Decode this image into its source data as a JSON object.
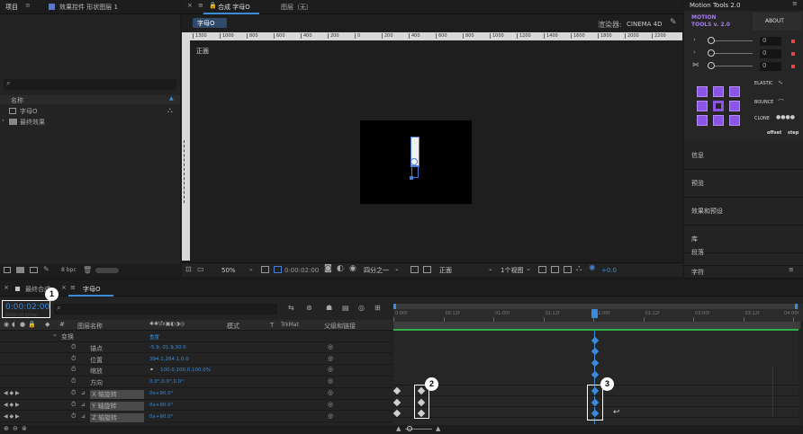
{
  "project_panel": {
    "title": "项目",
    "effects_tab": "效果控件 形状图层 1",
    "column_name": "名称",
    "items": [
      "字母O",
      "最终效果"
    ],
    "bpc": "8 bpc"
  },
  "composition_panel": {
    "tab": "合成 字母O",
    "layer_tab": "图层（无）",
    "comp_chip": "字母O",
    "renderer_label": "渲染器:",
    "renderer_value": "CINEMA 4D",
    "view_label": "正面",
    "ruler": [
      "1300",
      "1000",
      "800",
      "600",
      "400",
      "200",
      "0",
      "200",
      "400",
      "600",
      "800",
      "1000",
      "1200",
      "1400",
      "1600",
      "1800",
      "2000",
      "2200"
    ],
    "zoom": "50%",
    "timecode": "0:00:02:00",
    "resolution": "四分之一",
    "camera": "正面",
    "views": "1个视图",
    "exposure": "+0.0"
  },
  "motion_tools": {
    "title": "Motion Tools 2.0",
    "logo_line1": "MOTION",
    "logo_line2": "TOOLS v. 2.0",
    "about": "ABOUT",
    "slider_values": [
      "0",
      "0",
      "0"
    ],
    "slider_icons": [
      "angle-left-icon",
      "angle-right-icon",
      "split-icon"
    ],
    "elastic": "ELASTIC",
    "bounce": "BOUNCE",
    "clone": "CLONE",
    "offset": "offset",
    "step": "step",
    "accent": "#8c55e8"
  },
  "side_menu": [
    "信息",
    "预览",
    "效果和预设",
    "库",
    "段落",
    "字符"
  ],
  "timeline": {
    "tabs": [
      "最终合成",
      "字母O"
    ],
    "timecode": "0:00:02:00",
    "fps_sub": "00050 (25.00 fps)",
    "columns": {
      "layer_name": "图层名称",
      "mode": "模式",
      "t": "T",
      "trkmat": "TrkMat",
      "parent": "父级和链接"
    },
    "time_labels": [
      "0:00f",
      "00:12f",
      "01:00f",
      "01:12f",
      "02:00f",
      "02:12f",
      "03:00f",
      "03:12f",
      "04:00f"
    ],
    "rows": [
      {
        "name": "变换",
        "value": "重置",
        "indent": 1
      },
      {
        "name": "锚点",
        "value": "-5.9,-31.9,30.0",
        "indent": 2
      },
      {
        "name": "位置",
        "value": "394.1,284.1,0.0",
        "indent": 2
      },
      {
        "name": "缩放",
        "value": "100.0,100.0,100.0%",
        "indent": 2
      },
      {
        "name": "方向",
        "value": "0.0°,0.0°,0.0°",
        "indent": 2
      },
      {
        "name": "X 轴旋转",
        "value": "0x+90.0°",
        "indent": 2
      },
      {
        "name": "Y 轴旋转",
        "value": "0x+90.0°",
        "indent": 2
      },
      {
        "name": "Z 轴旋转",
        "value": "0x+90.0°",
        "indent": 2
      }
    ],
    "annotations": [
      "1",
      "2",
      "3"
    ]
  }
}
